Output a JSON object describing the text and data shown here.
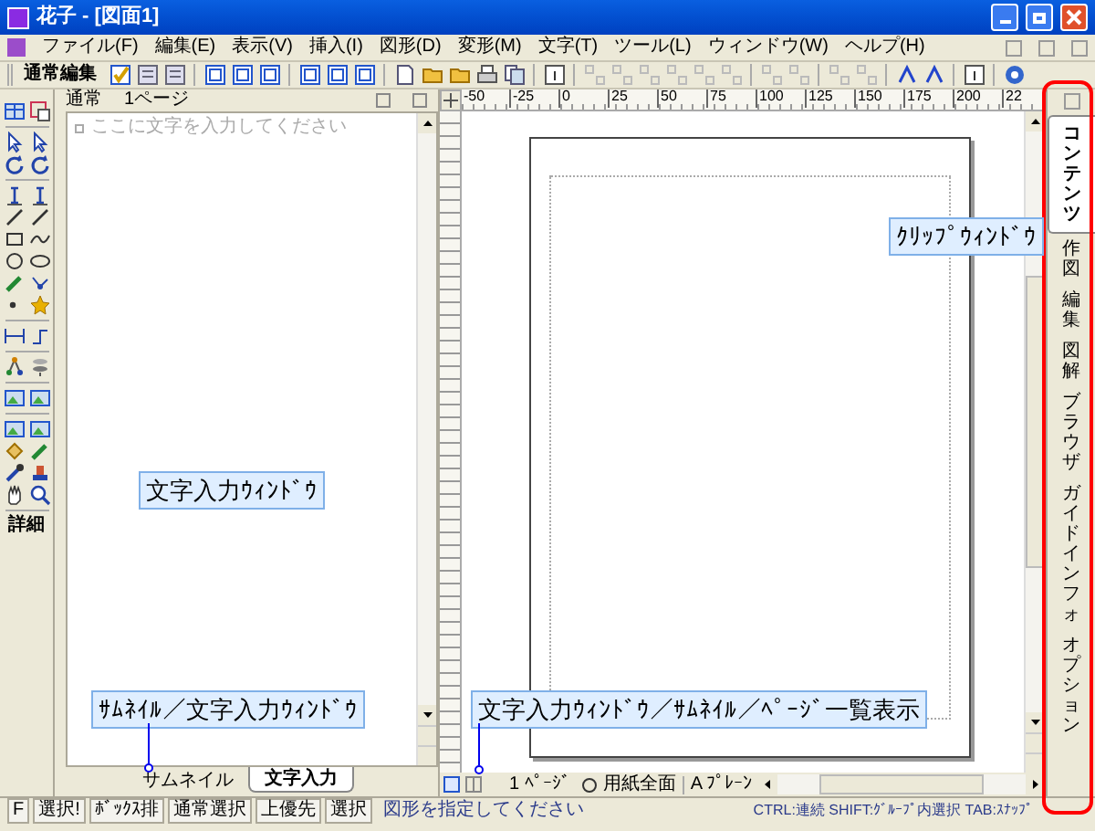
{
  "window": {
    "title": "花子 - [図面1]"
  },
  "menu": [
    "ファイル(F)",
    "編集(E)",
    "表示(V)",
    "挿入(I)",
    "図形(D)",
    "変形(M)",
    "文字(T)",
    "ツール(L)",
    "ウィンドウ(W)",
    "ヘルプ(H)"
  ],
  "toolbar": {
    "label": "通常編集"
  },
  "text_pane": {
    "header": "通常",
    "page": "1ページ",
    "placeholder": "ここに文字を入力してください",
    "tabs": [
      {
        "label": "サムネイル",
        "selected": false
      },
      {
        "label": "文字入力",
        "selected": true
      }
    ]
  },
  "palette": {
    "detail_button": "詳細"
  },
  "ruler": [
    "-50",
    "-25",
    "0",
    "25",
    "50",
    "75",
    "100",
    "125",
    "150",
    "175",
    "200",
    "22"
  ],
  "canvas_bar": {
    "page": "1 ﾍﾟｰｼﾞ",
    "zoom": "用紙全面",
    "mode": "A ﾌﾟﾚｰﾝ"
  },
  "side_tabs": [
    {
      "label": "コンテンツ",
      "selected": true
    },
    {
      "label": "作図",
      "selected": false
    },
    {
      "label": "編集",
      "selected": false
    },
    {
      "label": "図解",
      "selected": false
    },
    {
      "label": "ブラウザ",
      "selected": false
    },
    {
      "label": "ガイドインフォ",
      "selected": false
    },
    {
      "label": "オプション",
      "selected": false
    }
  ],
  "status_bar": {
    "items": [
      {
        "text": "F",
        "kind": "box"
      },
      {
        "text": "選択!",
        "kind": "box"
      },
      {
        "text": "ﾎﾞｯｸｽ排",
        "kind": "box"
      },
      {
        "text": "通常選択",
        "kind": "box"
      },
      {
        "text": "上優先",
        "kind": "box"
      },
      {
        "text": "選択",
        "kind": "box"
      },
      {
        "text": "図形を指定してください",
        "kind": "plain"
      }
    ],
    "hint": "CTRL:連続 SHIFT:ｸﾞﾙｰﾌﾟ内選択 TAB:ｽﾅｯﾌﾟ"
  },
  "callouts": [
    {
      "text": "文字入力ｳｨﾝﾄﾞｳ",
      "leader": false
    },
    {
      "text": "ｻﾑﾈｲﾙ／文字入力ｳｨﾝﾄﾞｳ",
      "leader": true
    },
    {
      "text": "文字入力ｳｨﾝﾄﾞｳ／ｻﾑﾈｲﾙ／ﾍﾟｰｼﾞ一覧表示",
      "leader": true
    },
    {
      "text": "ｸﾘｯﾌﾟｳｨﾝﾄﾞｳ",
      "leader": false
    }
  ]
}
